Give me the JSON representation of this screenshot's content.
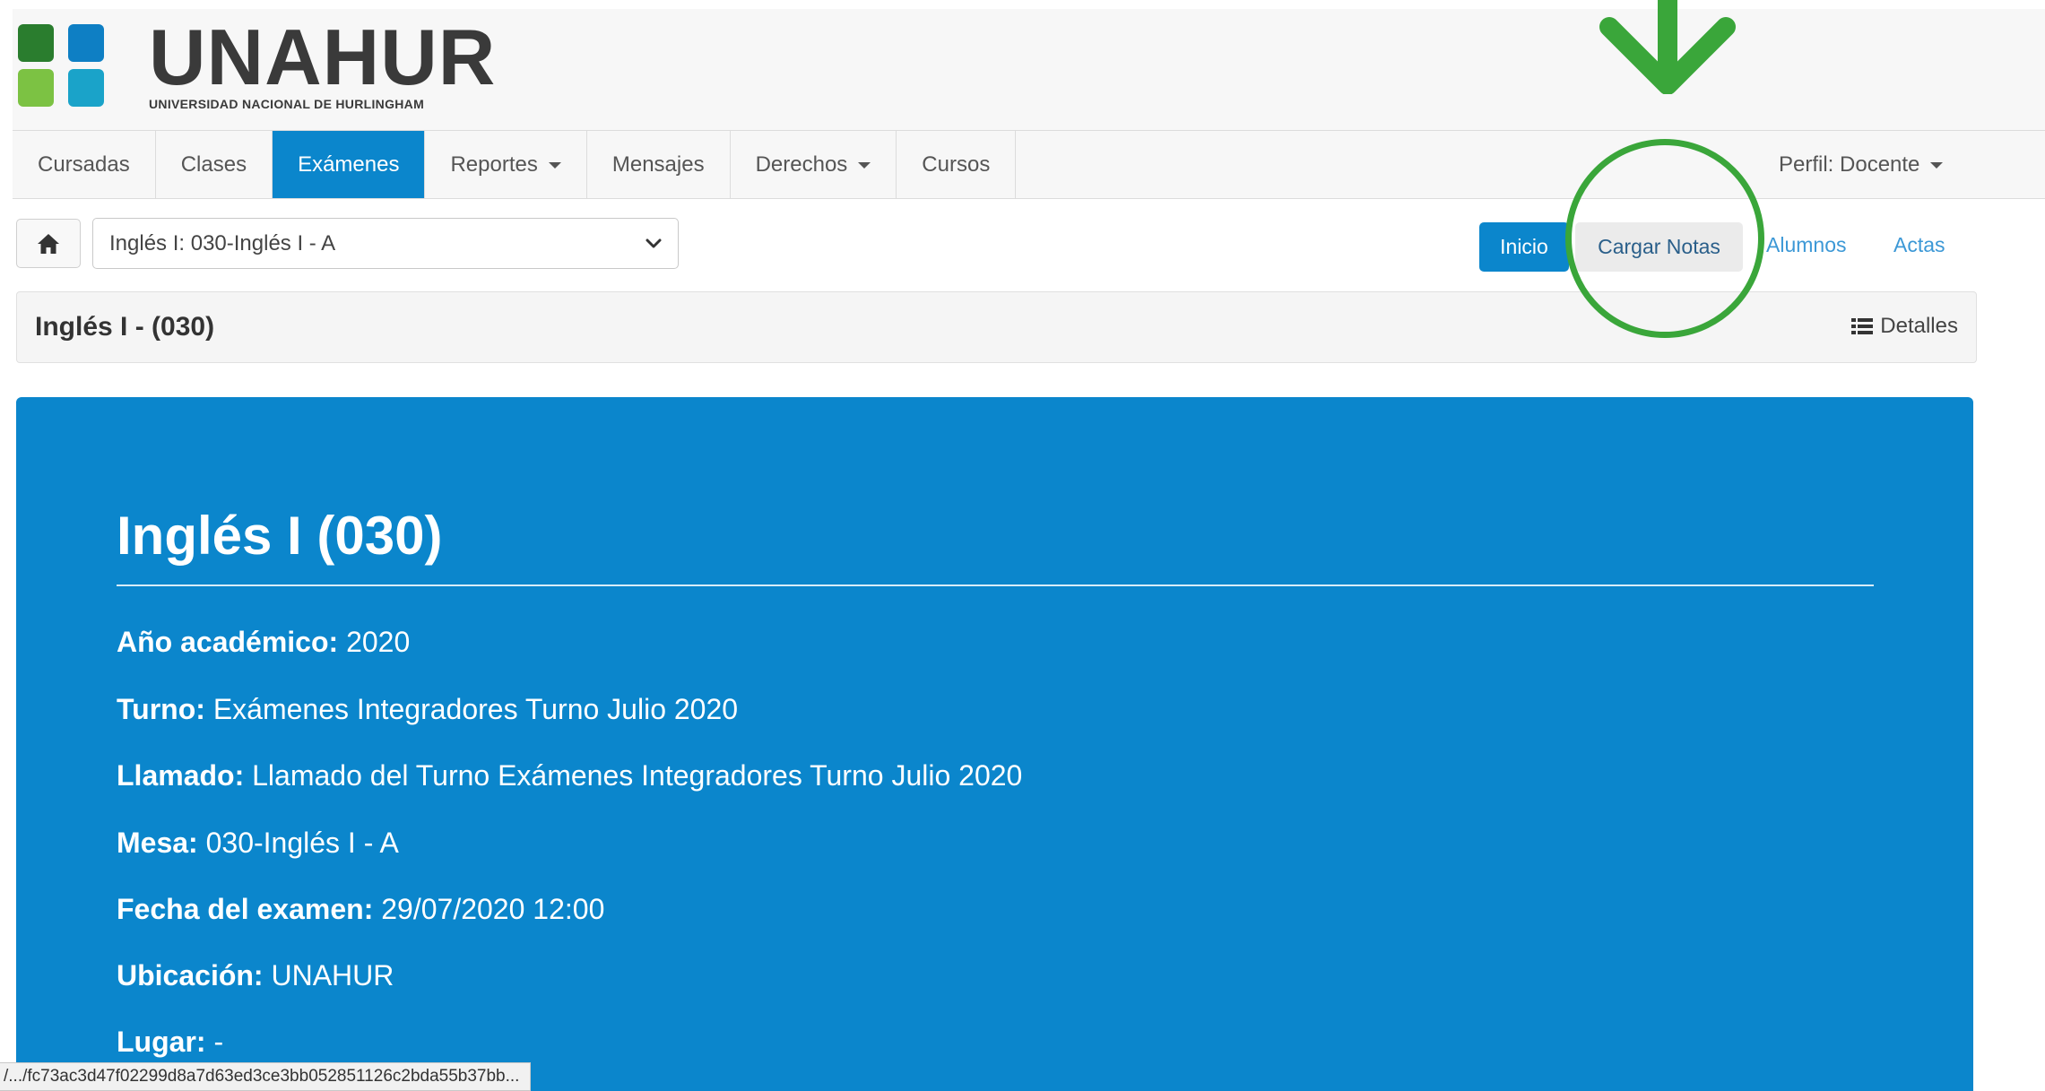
{
  "brand": {
    "title": "UNAHUR",
    "subtitle": "UNIVERSIDAD NACIONAL DE HURLINGHAM",
    "colors": {
      "dark_green": "#2a7d2e",
      "light_green": "#7cc243",
      "blue": "#0e7fc4",
      "teal": "#1aa3c9"
    }
  },
  "nav": {
    "items": [
      {
        "label": "Cursadas"
      },
      {
        "label": "Clases"
      },
      {
        "label": "Exámenes"
      },
      {
        "label": "Reportes"
      },
      {
        "label": "Mensajes"
      },
      {
        "label": "Derechos"
      },
      {
        "label": "Cursos"
      }
    ],
    "active": "Exámenes",
    "profile": "Perfil: Docente"
  },
  "toolbar": {
    "home_icon": "home-icon",
    "selected_exam": "Inglés I: 030-Inglés I - A",
    "buttons": {
      "inicio": "Inicio",
      "cargar_notas": "Cargar Notas",
      "alumnos": "Alumnos",
      "actas": "Actas"
    }
  },
  "panel": {
    "title": "Inglés I - (030)",
    "detalles": "Detalles",
    "detalles_icon": "list-icon"
  },
  "info": {
    "heading": "Inglés I (030)",
    "rows": [
      {
        "key": "Año académico:",
        "value": "2020"
      },
      {
        "key": "Turno:",
        "value": "Exámenes Integradores Turno Julio 2020"
      },
      {
        "key": "Llamado:",
        "value": "Llamado del Turno Exámenes Integradores Turno Julio 2020"
      },
      {
        "key": "Mesa:",
        "value": "030-Inglés I - A"
      },
      {
        "key": "Fecha del examen:",
        "value": "29/07/2020 12:00"
      },
      {
        "key": "Ubicación:",
        "value": "UNAHUR"
      },
      {
        "key": "Lugar:",
        "value": "-"
      }
    ]
  },
  "statusbar": {
    "url": "/.../fc73ac3d47f02299d8a7d63ed3ce3bb052851126c2bda55b37bb..."
  },
  "annotation": {
    "color": "#3aa63a",
    "arrow_icon": "arrow-down-icon",
    "circle_icon": "highlight-circle"
  },
  "colors": {
    "primary": "#0b86cc",
    "link": "#3c98d6",
    "navbar_bg": "#f7f7f7"
  }
}
